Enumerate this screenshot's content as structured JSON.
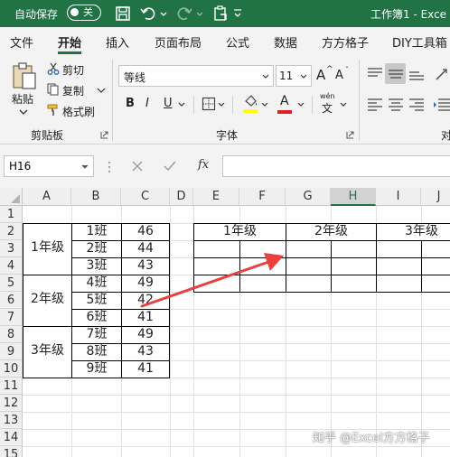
{
  "titlebar": {
    "autosave_label": "自动保存",
    "autosave_state": "关",
    "doc_title": "工作簿1 - Exce"
  },
  "tabs": [
    "文件",
    "开始",
    "插入",
    "页面布局",
    "公式",
    "数据",
    "方方格子",
    "DIY工具箱"
  ],
  "active_tab": "开始",
  "ribbon": {
    "clipboard": {
      "paste": "粘贴",
      "cut": "剪切",
      "copy": "复制",
      "format_painter": "格式刷",
      "group": "剪贴板"
    },
    "font": {
      "name": "等线",
      "size": "11",
      "grow": "A",
      "shrink": "A",
      "bold": "B",
      "italic": "I",
      "underline": "U",
      "font_color": "A",
      "phonetic_top": "wén",
      "phonetic": "文",
      "group": "字体"
    },
    "align_group_partial": "对"
  },
  "formula_bar": {
    "name_box": "H16",
    "fx": "fx",
    "formula": ""
  },
  "sheet": {
    "columns": [
      "A",
      "B",
      "C",
      "D",
      "E",
      "F",
      "G",
      "H",
      "I",
      "J"
    ],
    "selected_column": "H",
    "rows": [
      "1",
      "2",
      "3",
      "4",
      "5",
      "6",
      "7",
      "8",
      "9",
      "10",
      "11",
      "12",
      "13",
      "14",
      "15"
    ],
    "grades": [
      "1年级",
      "2年级",
      "3年级"
    ],
    "classes": [
      "1班",
      "2班",
      "3班",
      "4班",
      "5班",
      "6班",
      "7班",
      "8班",
      "9班"
    ],
    "values": [
      "46",
      "44",
      "43",
      "49",
      "42",
      "41",
      "49",
      "43",
      "41"
    ],
    "target_headers": [
      "1年级",
      "2年级",
      "3年级"
    ]
  },
  "watermark": "知乎 @Excel方方格子",
  "colors": {
    "brand": "#217346",
    "arrow": "#e8413f"
  }
}
